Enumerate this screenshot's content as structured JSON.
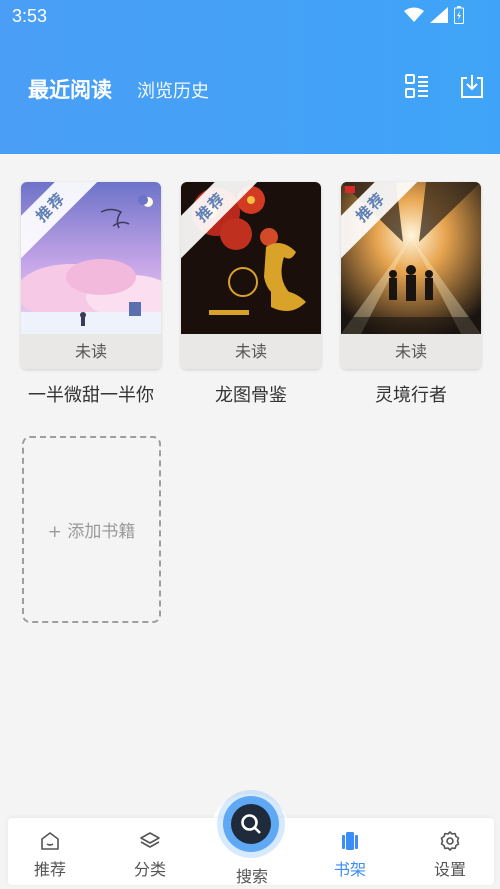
{
  "status_bar": {
    "time": "3:53",
    "icons": [
      "wifi-icon",
      "signal-icon",
      "battery-icon"
    ]
  },
  "header": {
    "tabs": [
      {
        "label": "最近阅读",
        "active": true
      },
      {
        "label": "浏览历史",
        "active": false
      }
    ],
    "actions": [
      {
        "icon": "list-view-icon"
      },
      {
        "icon": "import-icon"
      }
    ],
    "accent": "#4a9ef6"
  },
  "books": [
    {
      "title": "一半微甜一半你",
      "badge": "推荐",
      "status": "未读"
    },
    {
      "title": "龙图骨鉴",
      "badge": "推荐",
      "status": "未读"
    },
    {
      "title": "灵境行者",
      "badge": "推荐",
      "status": "未读"
    }
  ],
  "add_book": {
    "label": "+ 添加书籍"
  },
  "bottom_nav": {
    "items": [
      {
        "label": "推荐",
        "icon": "home-icon",
        "active": false
      },
      {
        "label": "分类",
        "icon": "layers-icon",
        "active": false
      },
      {
        "label": "搜索",
        "icon": "search-icon",
        "active": false
      },
      {
        "label": "书架",
        "icon": "bookshelf-icon",
        "active": true
      },
      {
        "label": "设置",
        "icon": "gear-icon",
        "active": false
      }
    ],
    "active_color": "#3c8ef6"
  }
}
